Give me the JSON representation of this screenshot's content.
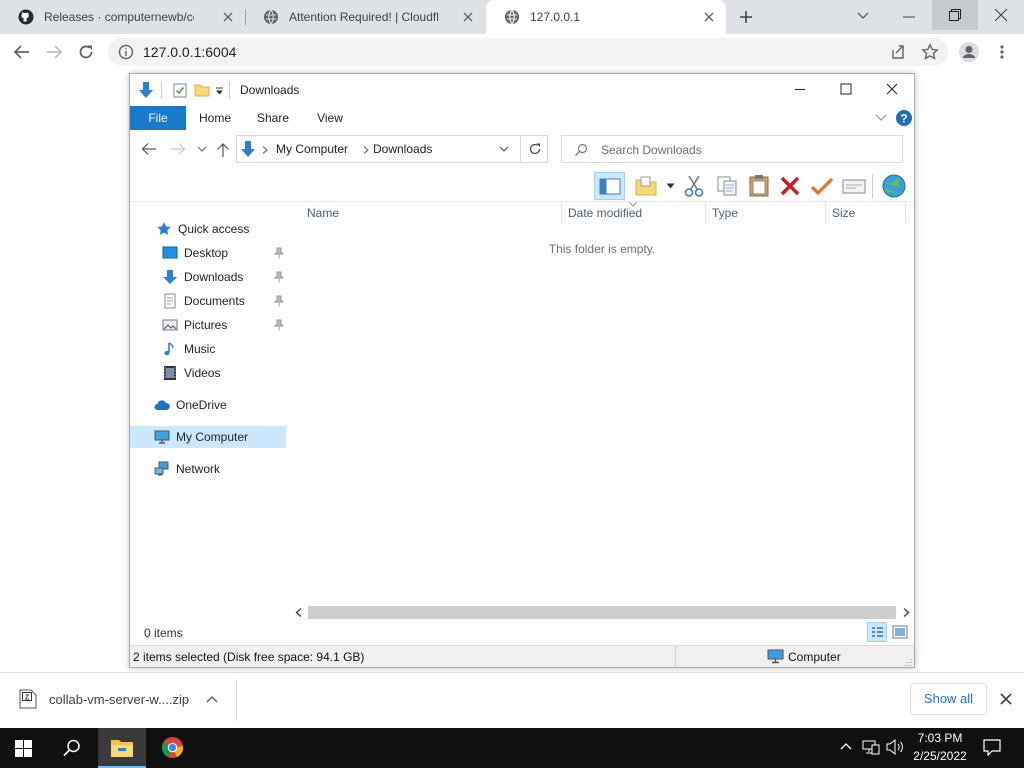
{
  "browser": {
    "tabs": [
      {
        "label": "Releases · computernewb/collab-vm",
        "icon": "github-icon"
      },
      {
        "label": "Attention Required! | Cloudflare",
        "icon": "globe-icon"
      },
      {
        "label": "127.0.0.1",
        "icon": "globe-icon",
        "active": true
      }
    ],
    "url": "127.0.0.1:6004"
  },
  "explorer": {
    "title": "Downloads",
    "ribbon_tabs": [
      "File",
      "Home",
      "Share",
      "View"
    ],
    "breadcrumb": [
      "My Computer",
      "Downloads"
    ],
    "search_placeholder": "Search Downloads",
    "nav": {
      "quick_access": "Quick access",
      "quick_items": [
        "Desktop",
        "Downloads",
        "Documents",
        "Pictures",
        "Music",
        "Videos"
      ],
      "onedrive": "OneDrive",
      "my_computer": "My Computer",
      "network": "Network"
    },
    "columns": [
      "Name",
      "Date modified",
      "Type",
      "Size"
    ],
    "empty_message": "This folder is empty.",
    "item_count": "0 items",
    "selection_status": "2 items selected (Disk free space: 94.1 GB)",
    "location": "Computer"
  },
  "download_shelf": {
    "filename": "collab-vm-server-w....zip",
    "show_all": "Show all"
  },
  "taskbar": {
    "time": "7:03 PM",
    "date": "2/25/2022"
  },
  "colors": {
    "accent": "#1979ca",
    "selected_nav": "#cce8ff",
    "taskbar": "#101010"
  }
}
